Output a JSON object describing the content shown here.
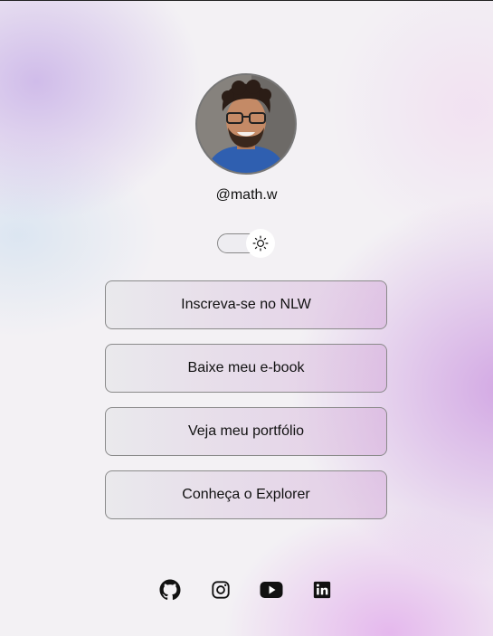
{
  "profile": {
    "username": "@math.w",
    "avatar_icon": "profile-photo"
  },
  "theme_switch": {
    "icon": "sun-icon",
    "state": "light"
  },
  "links": [
    {
      "label": "Inscreva-se no NLW"
    },
    {
      "label": "Baixe meu e-book"
    },
    {
      "label": "Veja meu portfólio"
    },
    {
      "label": "Conheça o Explorer"
    }
  ],
  "socials": [
    {
      "name": "github-icon"
    },
    {
      "name": "instagram-icon"
    },
    {
      "name": "youtube-icon"
    },
    {
      "name": "linkedin-icon"
    }
  ],
  "colors": {
    "text": "#111111",
    "button_border": "#8a8a8a",
    "accent_purple": "#cd9be1"
  }
}
